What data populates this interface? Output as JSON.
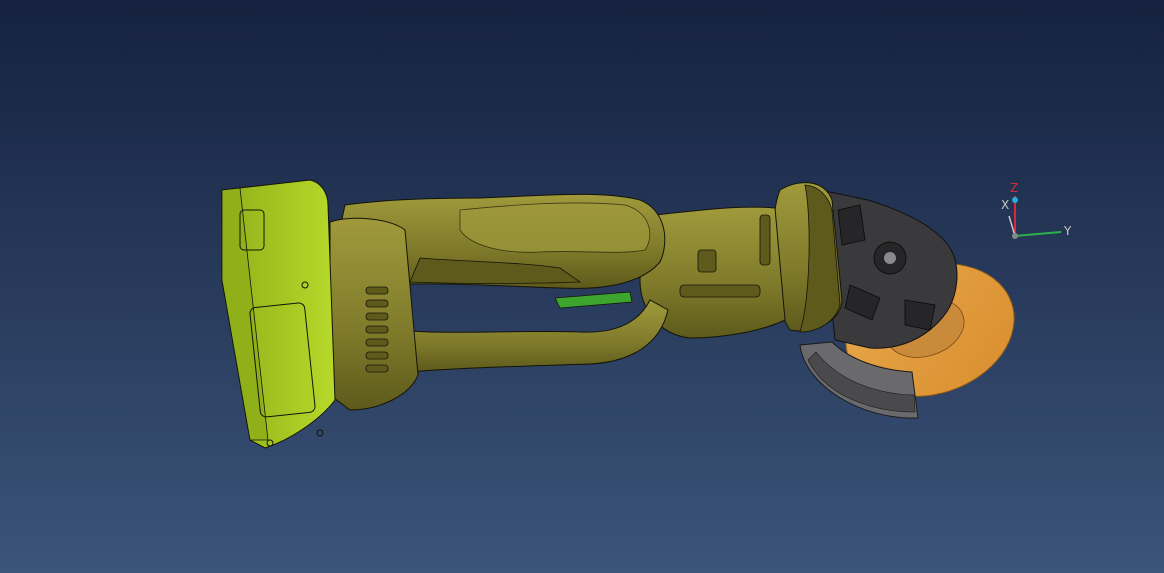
{
  "viewport": {
    "background_top": "#15213f",
    "background_bottom": "#3b5479"
  },
  "model": {
    "battery_color": "#b7d92a",
    "battery_shadow": "#8fb019",
    "body_color": "#7f7a2a",
    "body_shadow": "#5d5a1c",
    "body_highlight": "#a09a3c",
    "trigger_color": "#3da52e",
    "head_color": "#3a3a3c",
    "guard_color": "#6a6a6c",
    "disc_color": "#e8a84a",
    "edge_color": "#141408"
  },
  "triad": {
    "x_label": "X",
    "y_label": "Y",
    "z_label": "Z",
    "x_color": "#c6c6c6",
    "y_color": "#2bb24a",
    "z_color": "#d8283a",
    "origin_color": "#1fb2d6"
  }
}
